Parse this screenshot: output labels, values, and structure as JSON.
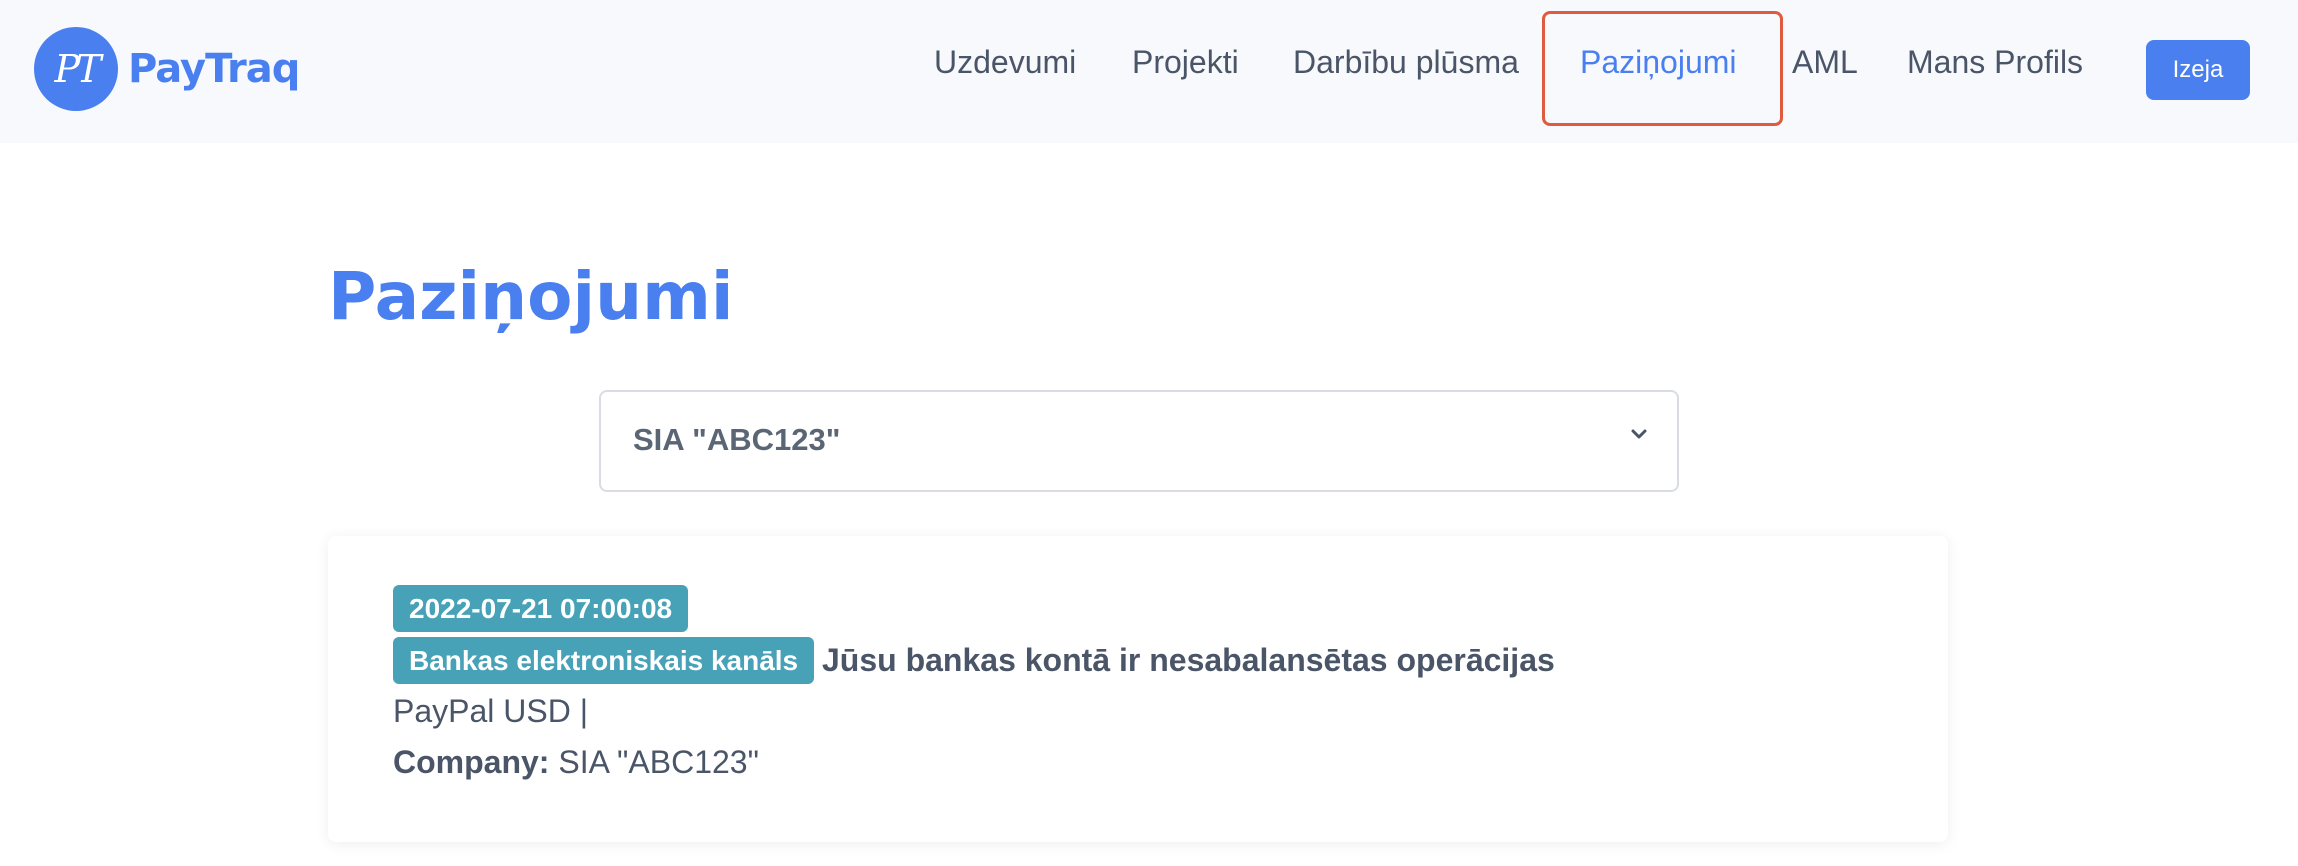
{
  "header": {
    "logo_monogram": "PT",
    "logo_text": "PayTraq",
    "nav": {
      "tasks": "Uzdevumi",
      "projects": "Projekti",
      "activity": "Darbību plūsma",
      "notifications": "Paziņojumi",
      "aml": "AML",
      "profile": "Mans Profils"
    },
    "active_nav": "notifications",
    "logout_label": "Izeja"
  },
  "page": {
    "title": "Paziņojumi"
  },
  "company_select": {
    "selected": "SIA \"ABC123\""
  },
  "notifications": [
    {
      "datetime": "2022-07-21 07:00:08",
      "channel": "Bankas elektroniskais kanāls",
      "title": "Jūsu bankas kontā ir nesabalansētas operācijas",
      "account": "PayPal USD |",
      "company_label": "Company:",
      "company": "SIA \"ABC123\""
    }
  ],
  "colors": {
    "accent": "#4a7ff0",
    "badge": "#47a2b8",
    "highlight": "#e05a3f",
    "navbar_bg": "#f7f9fc",
    "text": "#4a5568"
  },
  "icons": {
    "select_arrow": "chevron-down-icon"
  }
}
